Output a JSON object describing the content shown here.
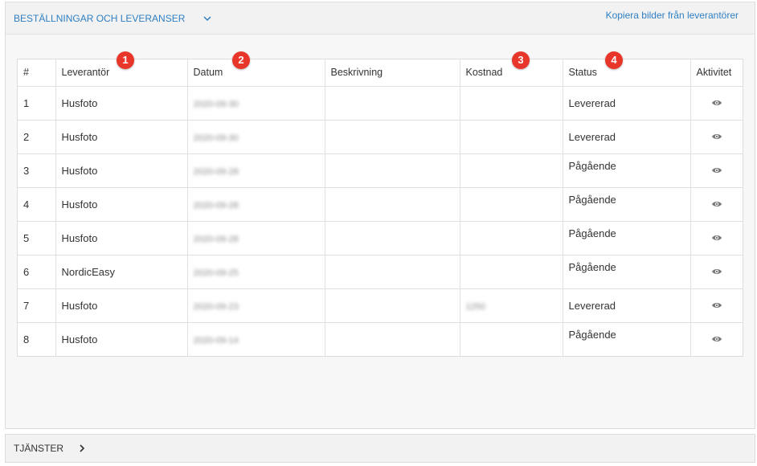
{
  "orders_panel": {
    "title": "BESTÄLLNINGAR OCH LEVERANSER",
    "copy_link": "Kopiera bilder från leverantörer"
  },
  "table": {
    "headers": [
      "#",
      "Leverantör",
      "Datum",
      "Beskrivning",
      "Kostnad",
      "Status",
      "Aktivitet"
    ],
    "rows": [
      {
        "num": "1",
        "supplier": "Husfoto",
        "date": "2020-09-30",
        "description": "",
        "cost": "",
        "status": "Levererad"
      },
      {
        "num": "2",
        "supplier": "Husfoto",
        "date": "2020-09-30",
        "description": "",
        "cost": "",
        "status": "Levererad"
      },
      {
        "num": "3",
        "supplier": "Husfoto",
        "date": "2020-09-28",
        "description": "",
        "cost": "",
        "status": "Pågående"
      },
      {
        "num": "4",
        "supplier": "Husfoto",
        "date": "2020-09-28",
        "description": "",
        "cost": "",
        "status": "Pågående"
      },
      {
        "num": "5",
        "supplier": "Husfoto",
        "date": "2020-09-28",
        "description": "",
        "cost": "",
        "status": "Pågående"
      },
      {
        "num": "6",
        "supplier": "NordicEasy",
        "date": "2020-09-25",
        "description": "",
        "cost": "",
        "status": "Pågående"
      },
      {
        "num": "7",
        "supplier": "Husfoto",
        "date": "2020-09-23",
        "description": "",
        "cost": "1250",
        "status": "Levererad"
      },
      {
        "num": "8",
        "supplier": "Husfoto",
        "date": "2020-09-14",
        "description": "",
        "cost": "",
        "status": "Pågående"
      }
    ]
  },
  "badges": [
    "1",
    "2",
    "3",
    "4"
  ],
  "services_panel": {
    "title": "TJÄNSTER"
  },
  "colors": {
    "accent": "#2f7fc3",
    "badge": "#e8362a"
  }
}
